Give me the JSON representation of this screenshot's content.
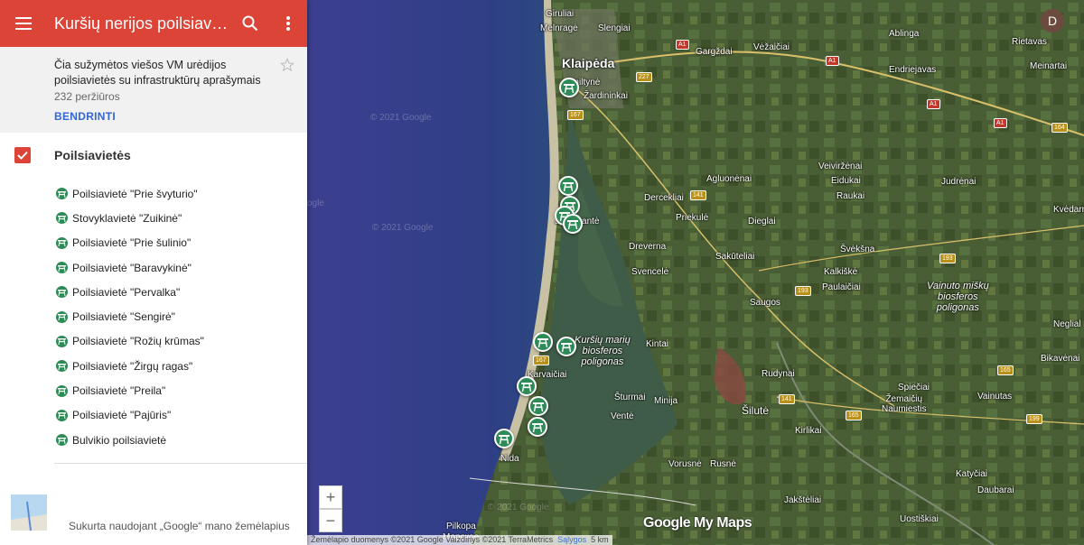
{
  "header": {
    "title": "Kuršių nerijos poilsiaviet…",
    "menu_icon": "hamburger-icon",
    "search_icon": "search-icon",
    "more_icon": "more-vert-icon"
  },
  "info": {
    "description": "Čia sužymėtos viešos VM urėdijos poilsiavietės su infrastruktūrų aprašymais",
    "views": "232 peržiūros",
    "share": "BENDRINTI"
  },
  "layer": {
    "name": "Poilsiavietės",
    "checked": true
  },
  "items": [
    "Poilsiavietė \"Prie švyturio\"",
    "Stovyklavietė \"Zuikinė\"",
    "Poilsiavietė \"Prie šulinio\"",
    "Poilsiavietė \"Baravykinė\"",
    "Poilsiavietė \"Pervalka\"",
    "Poilsiavietė \"Sengirė\"",
    "Poilsiavietė \"Rožių krūmas\"",
    "Poilsiavietė \"Žirgų ragas\"",
    "Poilsiavietė \"Preila\"",
    "Poilsiavietė \"Pajūris\"",
    "Bulvikio poilsiavietė"
  ],
  "footer": {
    "made_with": "Sukurta naudojant „Google“ mano žemėlapius"
  },
  "map": {
    "avatar_letter": "D",
    "zoom_in": "+",
    "zoom_out": "−",
    "logo": "Google My Maps",
    "attribution": "Žemėlapio duomenys ©2021 Google Vaizdinys ©2021 TerraMetrics",
    "terms": "Sąlygos",
    "scale": "5 km",
    "watermarks": [
      "© 2021 Google",
      "© 2021 Google",
      "© 2021 Google",
      "ogle"
    ],
    "places": {
      "giruliai": "Giruliai",
      "melnrage": "Melnragė",
      "slengiai": "Slengiai",
      "klaipeda": "Klaipėda",
      "smiltyne": "Smiltynė",
      "zardininkai": "Žardininkai",
      "gargzdai": "Gargždai",
      "vezaiciai": "Vėžaičiai",
      "ablinga": "Ablinga",
      "rietavas": "Rietavas",
      "endriejavas": "Endriejavas",
      "meinartai": "Meinartai",
      "agluonenai": "Agluonėnai",
      "veivirzenai": "Veiviržėnai",
      "eidukai": "Eidukai",
      "raukai": "Raukai",
      "judrenai": "Judrėnai",
      "dercekliai": "Dercekliai",
      "priekule": "Priekulė",
      "dieglai": "Dieglai",
      "kvedarna": "Kvėdarna",
      "juodkrante": "Juodkrantė",
      "dreverna": "Dreverna",
      "sakuteliai": "Sakūteliai",
      "sveksna": "Švėkšna",
      "svencele": "Svencelė",
      "kalkiske": "Kalkiškė",
      "paulaiciai": "Paulaičiai",
      "saugos": "Saugos",
      "vainuto": "Vainuto miškų\nbiosferos\npoligonas",
      "kursiu": "Kuršių marių\nbiosferos\npoligonas",
      "kintai": "Kintai",
      "rudynai": "Rudynai",
      "pervalka": "Karvaičiai",
      "spieciai": "Spiečiai",
      "zemaiciu": "Žemaičių\nNaumiestis",
      "vainutas": "Vainutas",
      "sturmai": "Šturmai",
      "minija": "Minija",
      "silute": "Šilutė",
      "vente": "Ventė",
      "kirlikai": "Kirlikai",
      "nida": "Nida",
      "rusne": "Rusnė",
      "vorusne": "Vorusnė",
      "katyciai": "Katyčiai",
      "jakstelia": "Jakštėliai",
      "daubarai": "Daubarai",
      "pilkopa": "Pilkopa",
      "morskoe": "Морское",
      "uostiskiai": "Uostiškiai",
      "bikaviskes": "Bikavėnai",
      "neglial": "Neglial"
    },
    "roads": [
      "A1",
      "A1",
      "A1",
      "A1",
      "227",
      "167",
      "141",
      "141",
      "193",
      "193",
      "167",
      "141",
      "165",
      "165",
      "199",
      "164",
      "141"
    ],
    "pin_icon": "picnic-table-icon"
  }
}
